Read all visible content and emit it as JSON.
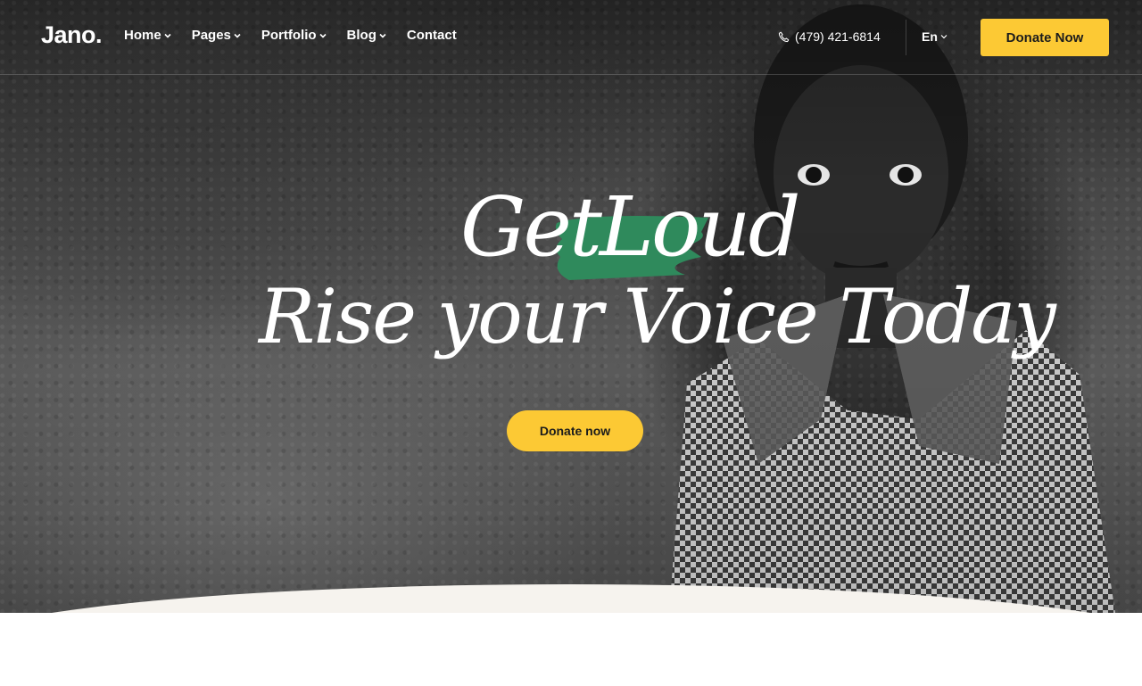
{
  "brand": {
    "logo": "Jano."
  },
  "nav": {
    "items": [
      {
        "label": "Home",
        "has_dropdown": true
      },
      {
        "label": "Pages",
        "has_dropdown": true
      },
      {
        "label": "Portfolio",
        "has_dropdown": true
      },
      {
        "label": "Blog",
        "has_dropdown": true
      },
      {
        "label": "Contact",
        "has_dropdown": false
      }
    ]
  },
  "header": {
    "phone": "(479) 421-6814",
    "language": "En",
    "donate_label": "Donate Now"
  },
  "hero": {
    "line1_a": "Get",
    "line1_b": "Loud",
    "line2": "Rise your Voice Today",
    "cta_label": "Donate now"
  },
  "colors": {
    "accent_yellow": "#fcc934",
    "brush_green": "#2f8a5c",
    "text_white": "#ffffff"
  },
  "icons": [
    "phone-icon",
    "chevron-down-icon"
  ]
}
